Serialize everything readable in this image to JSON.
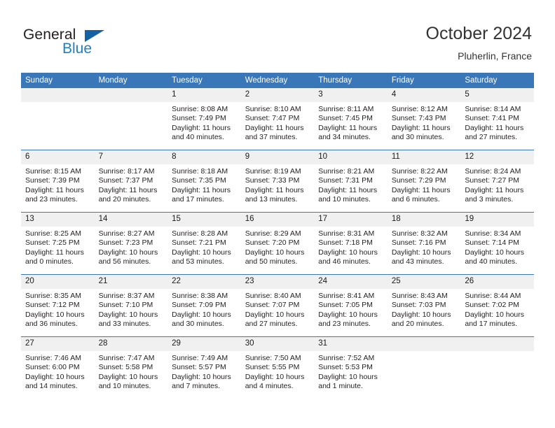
{
  "brand": {
    "name_part1": "General",
    "name_part2": "Blue"
  },
  "header": {
    "title": "October 2024",
    "subtitle": "Pluherlin, France"
  },
  "colors": {
    "header_blue": "#3A77B8",
    "logo_blue": "#1462a5",
    "daynum_band": "#F0F0F0"
  },
  "weekday_headers": [
    "Sunday",
    "Monday",
    "Tuesday",
    "Wednesday",
    "Thursday",
    "Friday",
    "Saturday"
  ],
  "weeks": [
    [
      {
        "day": "",
        "info": ""
      },
      {
        "day": "",
        "info": ""
      },
      {
        "day": "1",
        "info": "Sunrise: 8:08 AM\nSunset: 7:49 PM\nDaylight: 11 hours\nand 40 minutes."
      },
      {
        "day": "2",
        "info": "Sunrise: 8:10 AM\nSunset: 7:47 PM\nDaylight: 11 hours\nand 37 minutes."
      },
      {
        "day": "3",
        "info": "Sunrise: 8:11 AM\nSunset: 7:45 PM\nDaylight: 11 hours\nand 34 minutes."
      },
      {
        "day": "4",
        "info": "Sunrise: 8:12 AM\nSunset: 7:43 PM\nDaylight: 11 hours\nand 30 minutes."
      },
      {
        "day": "5",
        "info": "Sunrise: 8:14 AM\nSunset: 7:41 PM\nDaylight: 11 hours\nand 27 minutes."
      }
    ],
    [
      {
        "day": "6",
        "info": "Sunrise: 8:15 AM\nSunset: 7:39 PM\nDaylight: 11 hours\nand 23 minutes."
      },
      {
        "day": "7",
        "info": "Sunrise: 8:17 AM\nSunset: 7:37 PM\nDaylight: 11 hours\nand 20 minutes."
      },
      {
        "day": "8",
        "info": "Sunrise: 8:18 AM\nSunset: 7:35 PM\nDaylight: 11 hours\nand 17 minutes."
      },
      {
        "day": "9",
        "info": "Sunrise: 8:19 AM\nSunset: 7:33 PM\nDaylight: 11 hours\nand 13 minutes."
      },
      {
        "day": "10",
        "info": "Sunrise: 8:21 AM\nSunset: 7:31 PM\nDaylight: 11 hours\nand 10 minutes."
      },
      {
        "day": "11",
        "info": "Sunrise: 8:22 AM\nSunset: 7:29 PM\nDaylight: 11 hours\nand 6 minutes."
      },
      {
        "day": "12",
        "info": "Sunrise: 8:24 AM\nSunset: 7:27 PM\nDaylight: 11 hours\nand 3 minutes."
      }
    ],
    [
      {
        "day": "13",
        "info": "Sunrise: 8:25 AM\nSunset: 7:25 PM\nDaylight: 11 hours\nand 0 minutes."
      },
      {
        "day": "14",
        "info": "Sunrise: 8:27 AM\nSunset: 7:23 PM\nDaylight: 10 hours\nand 56 minutes."
      },
      {
        "day": "15",
        "info": "Sunrise: 8:28 AM\nSunset: 7:21 PM\nDaylight: 10 hours\nand 53 minutes."
      },
      {
        "day": "16",
        "info": "Sunrise: 8:29 AM\nSunset: 7:20 PM\nDaylight: 10 hours\nand 50 minutes."
      },
      {
        "day": "17",
        "info": "Sunrise: 8:31 AM\nSunset: 7:18 PM\nDaylight: 10 hours\nand 46 minutes."
      },
      {
        "day": "18",
        "info": "Sunrise: 8:32 AM\nSunset: 7:16 PM\nDaylight: 10 hours\nand 43 minutes."
      },
      {
        "day": "19",
        "info": "Sunrise: 8:34 AM\nSunset: 7:14 PM\nDaylight: 10 hours\nand 40 minutes."
      }
    ],
    [
      {
        "day": "20",
        "info": "Sunrise: 8:35 AM\nSunset: 7:12 PM\nDaylight: 10 hours\nand 36 minutes."
      },
      {
        "day": "21",
        "info": "Sunrise: 8:37 AM\nSunset: 7:10 PM\nDaylight: 10 hours\nand 33 minutes."
      },
      {
        "day": "22",
        "info": "Sunrise: 8:38 AM\nSunset: 7:09 PM\nDaylight: 10 hours\nand 30 minutes."
      },
      {
        "day": "23",
        "info": "Sunrise: 8:40 AM\nSunset: 7:07 PM\nDaylight: 10 hours\nand 27 minutes."
      },
      {
        "day": "24",
        "info": "Sunrise: 8:41 AM\nSunset: 7:05 PM\nDaylight: 10 hours\nand 23 minutes."
      },
      {
        "day": "25",
        "info": "Sunrise: 8:43 AM\nSunset: 7:03 PM\nDaylight: 10 hours\nand 20 minutes."
      },
      {
        "day": "26",
        "info": "Sunrise: 8:44 AM\nSunset: 7:02 PM\nDaylight: 10 hours\nand 17 minutes."
      }
    ],
    [
      {
        "day": "27",
        "info": "Sunrise: 7:46 AM\nSunset: 6:00 PM\nDaylight: 10 hours\nand 14 minutes."
      },
      {
        "day": "28",
        "info": "Sunrise: 7:47 AM\nSunset: 5:58 PM\nDaylight: 10 hours\nand 10 minutes."
      },
      {
        "day": "29",
        "info": "Sunrise: 7:49 AM\nSunset: 5:57 PM\nDaylight: 10 hours\nand 7 minutes."
      },
      {
        "day": "30",
        "info": "Sunrise: 7:50 AM\nSunset: 5:55 PM\nDaylight: 10 hours\nand 4 minutes."
      },
      {
        "day": "31",
        "info": "Sunrise: 7:52 AM\nSunset: 5:53 PM\nDaylight: 10 hours\nand 1 minute."
      },
      {
        "day": "",
        "info": ""
      },
      {
        "day": "",
        "info": ""
      }
    ]
  ]
}
